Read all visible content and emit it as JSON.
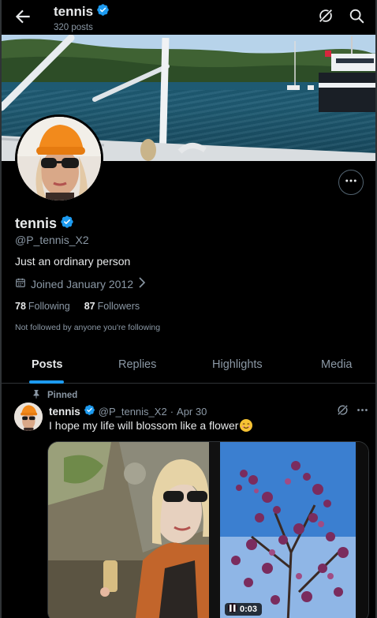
{
  "header": {
    "title": "tennis",
    "posts_count": "320 posts"
  },
  "profile": {
    "name": "tennis",
    "handle": "@P_tennis_X2",
    "bio": "Just an ordinary person",
    "joined": "Joined January 2012",
    "following_count": "78",
    "following_label": "Following",
    "followers_count": "87",
    "followers_label": "Followers",
    "not_followed": "Not followed by anyone you're following"
  },
  "tabs": [
    {
      "label": "Posts",
      "active": true
    },
    {
      "label": "Replies",
      "active": false
    },
    {
      "label": "Highlights",
      "active": false
    },
    {
      "label": "Media",
      "active": false
    }
  ],
  "post": {
    "pinned_label": "Pinned",
    "author_name": "tennis",
    "author_handle": "@P_tennis_X2",
    "separator": "·",
    "date": "Apr 30",
    "text": "I hope my life will blossom like a flower",
    "emoji": "smiling-face-emoji",
    "video_duration": "0:03"
  },
  "colors": {
    "accent": "#1d9bf0",
    "background": "#000000",
    "secondary_text": "#8b98a5",
    "border": "#2f3336"
  },
  "icons": {
    "back": "arrow-left-icon",
    "verified": "verified-badge-icon",
    "grok": "grok-icon",
    "search": "search-icon",
    "more": "more-horizontal-icon",
    "calendar": "calendar-icon",
    "pin": "pin-icon",
    "play": "play-icon"
  }
}
